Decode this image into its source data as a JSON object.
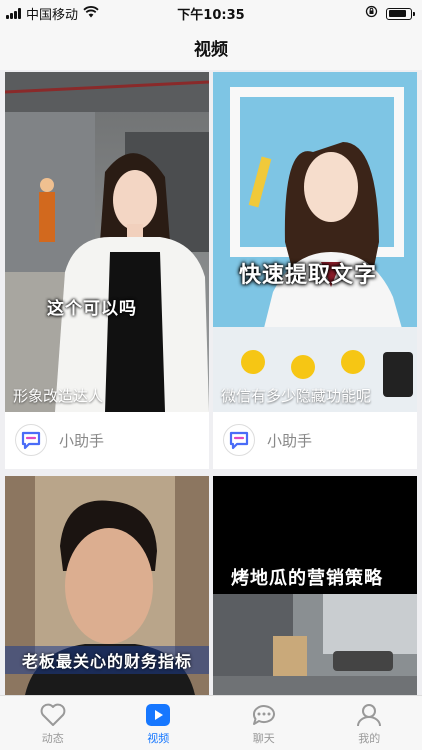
{
  "status": {
    "carrier": "中国移动",
    "time": "下午10:35"
  },
  "nav": {
    "title": "视频"
  },
  "cards": [
    {
      "caption": "形象改造达人",
      "overlay": "这个可以吗",
      "author": "小助手"
    },
    {
      "caption": "微信有多少隐藏功能呢",
      "overlay": "快速提取文字",
      "author": "小助手"
    },
    {
      "overlay": "老板最关心的财务指标"
    },
    {
      "overlay": "烤地瓜的营销策略"
    }
  ],
  "tabs": [
    {
      "label": "动态",
      "icon": "heart-icon"
    },
    {
      "label": "视频",
      "icon": "video-play-icon"
    },
    {
      "label": "聊天",
      "icon": "chat-bubble-icon"
    },
    {
      "label": "我的",
      "icon": "person-icon"
    }
  ],
  "colors": {
    "accent": "#1677ff",
    "inactive": "#999999"
  }
}
